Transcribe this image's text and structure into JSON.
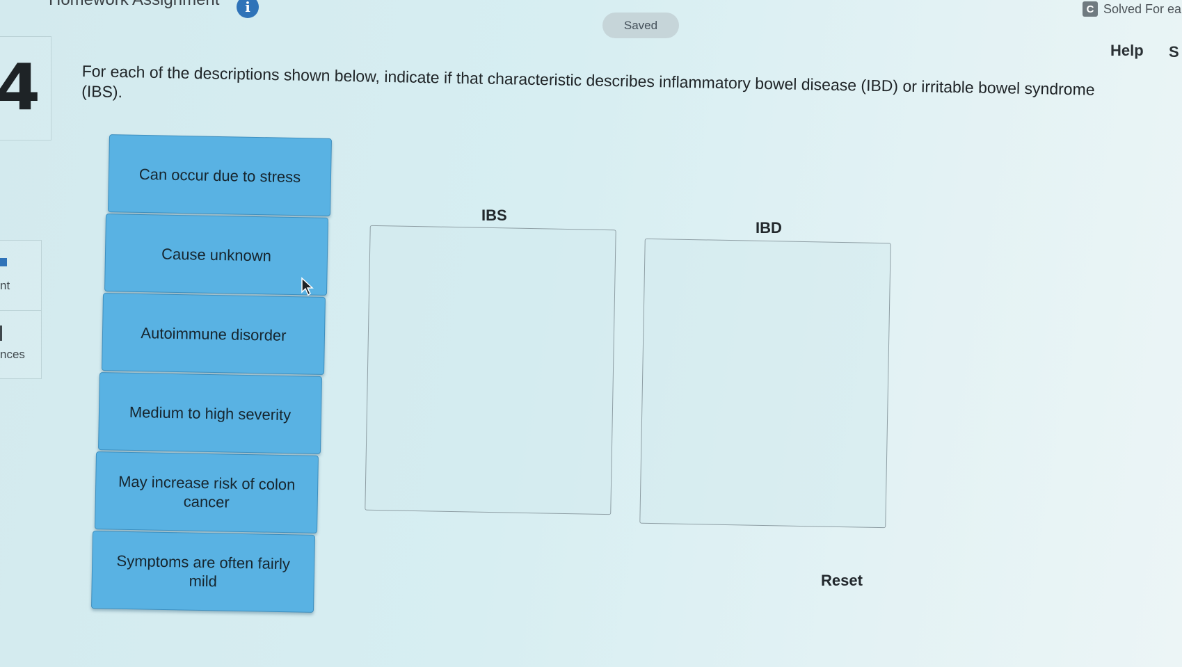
{
  "header": {
    "assignment_title": "Homework Assignment",
    "saved_label": "Saved",
    "solved_tab_letter": "C",
    "solved_tab_label": "Solved For ea",
    "help_label": "Help",
    "secondary_link_label": "S"
  },
  "sidebar": {
    "question_number": "4",
    "tab_1_label": "nt",
    "tab_2_label": "nces"
  },
  "question": {
    "prompt": "For each of the descriptions shown below, indicate if that characteristic describes inflammatory bowel disease (IBD) or irritable bowel syndrome (IBS)."
  },
  "cards": [
    {
      "label": "Can occur due to stress"
    },
    {
      "label": "Cause unknown"
    },
    {
      "label": "Autoimmune disorder"
    },
    {
      "label": "Medium to high severity"
    },
    {
      "label": "May increase risk of colon cancer"
    },
    {
      "label": "Symptoms are often fairly mild"
    }
  ],
  "bins": [
    {
      "label": "IBS"
    },
    {
      "label": "IBD"
    }
  ],
  "reset_label": "Reset",
  "colors": {
    "card_fill": "#59b2e3",
    "accent": "#2f73b8"
  }
}
